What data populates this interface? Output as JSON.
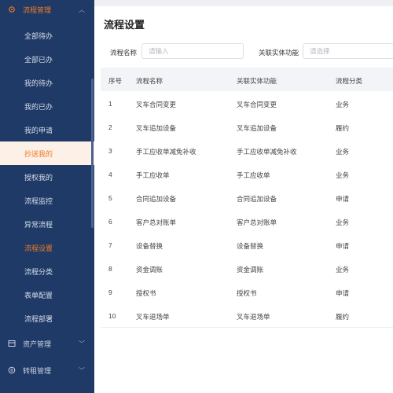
{
  "sidebar": {
    "top_group": {
      "label": "流程管理",
      "icon": "gear-icon"
    },
    "items": [
      {
        "label": "全部待办"
      },
      {
        "label": "全部已办"
      },
      {
        "label": "我的待办"
      },
      {
        "label": "我的已办"
      },
      {
        "label": "我的申请"
      },
      {
        "label": "抄送我的"
      },
      {
        "label": "授权我的"
      },
      {
        "label": "流程监控"
      },
      {
        "label": "异常流程"
      },
      {
        "label": "流程设置"
      },
      {
        "label": "流程分类"
      },
      {
        "label": "表单配置"
      },
      {
        "label": "流程部署"
      }
    ],
    "groups": [
      {
        "label": "资产管理",
        "icon": "asset-icon"
      },
      {
        "label": "转租管理",
        "icon": "sublease-icon"
      }
    ]
  },
  "main": {
    "title": "流程设置",
    "filters": {
      "name_label": "流程名称",
      "name_placeholder": "请输入",
      "entity_label": "关联实体功能",
      "entity_placeholder": "请选择"
    },
    "table": {
      "headers": [
        "序号",
        "流程名称",
        "关联实体功能",
        "流程分类"
      ],
      "rows": [
        [
          "1",
          "叉车合同变更",
          "叉车合同变更",
          "业务"
        ],
        [
          "2",
          "叉车追加设备",
          "叉车追加设备",
          "履约"
        ],
        [
          "3",
          "手工应收单减免补收",
          "手工应收单减免补收",
          "业务"
        ],
        [
          "4",
          "手工应收单",
          "手工应收单",
          "业务"
        ],
        [
          "5",
          "合同追加设备",
          "合同追加设备",
          "申请"
        ],
        [
          "6",
          "客户总对账单",
          "客户总对账单",
          "业务"
        ],
        [
          "7",
          "设备替换",
          "设备替换",
          "申请"
        ],
        [
          "8",
          "资金调账",
          "资金调账",
          "业务"
        ],
        [
          "9",
          "授权书",
          "授权书",
          "申请"
        ],
        [
          "10",
          "叉车退场单",
          "叉车退场单",
          "履约"
        ]
      ]
    }
  },
  "colors": {
    "sidebar_bg": "#1f3a66",
    "accent": "#ef7a26",
    "active_bg": "#fdf0e6"
  }
}
